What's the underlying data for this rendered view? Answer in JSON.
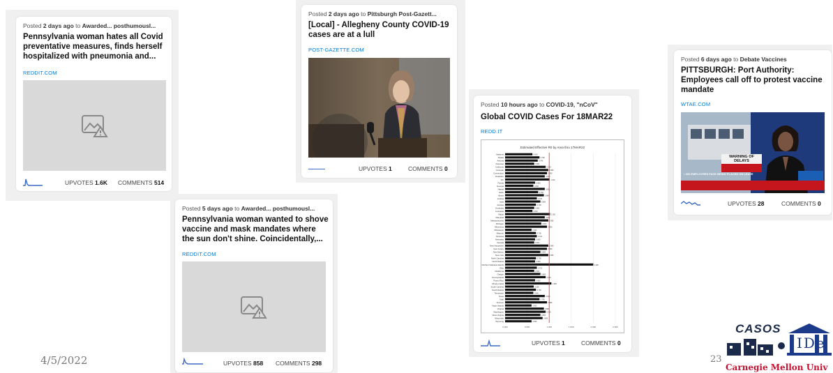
{
  "cards": [
    {
      "posted_prefix": "Posted",
      "time": "2 days ago",
      "to": "to",
      "subreddit": "Awarded... posthumousl...",
      "title_lines": [
        "Pennsylvania woman hates all Covid",
        "preventative measures, finds herself",
        "hospitalized with pneumonia and..."
      ],
      "domain": "REDDIT.COM",
      "upvotes_label": "UPVOTES",
      "upvotes": "1.6K",
      "comments_label": "COMMENTS",
      "comments": "514"
    },
    {
      "posted_prefix": "Posted",
      "time": "2 days ago",
      "to": "to",
      "subreddit": "Pittsburgh Post-Gazett...",
      "title_lines": [
        "[Local] - Allegheny County COVID-19",
        "cases are at a lull"
      ],
      "domain": "POST-GAZETTE.COM",
      "upvotes_label": "UPVOTES",
      "upvotes": "1",
      "comments_label": "COMMENTS",
      "comments": "0"
    },
    {
      "posted_prefix": "Posted",
      "time": "5 days ago",
      "to": "to",
      "subreddit": "Awarded... posthumousl...",
      "title_lines": [
        "Pennsylvania woman wanted to shove",
        "vaccine and mask mandates where",
        "the sun don't shine. Coincidentally,..."
      ],
      "domain": "REDDIT.COM",
      "upvotes_label": "UPVOTES",
      "upvotes": "858",
      "comments_label": "COMMENTS",
      "comments": "298"
    },
    {
      "posted_prefix": "Posted",
      "time": "10 hours ago",
      "to": "to",
      "subreddit": "COVID-19, \"nCoV\"",
      "title_lines": [
        "Global COVID Cases For 18MAR22"
      ],
      "domain": "REDD.IT",
      "chart_title": "Estimated Effective R0 by Area thru 17MAR22",
      "upvotes_label": "UPVOTES",
      "upvotes": "1",
      "comments_label": "COMMENTS",
      "comments": "0"
    },
    {
      "posted_prefix": "Posted",
      "time": "6 days ago",
      "to": "to",
      "subreddit": "Debate Vaccines",
      "title_lines": [
        "PITTSBURGH: Port Authority:",
        "Employees call off to protest vaccine",
        "mandate"
      ],
      "domain": "WTAE.COM",
      "thumb_banner": "WARNING OF DELAYS",
      "thumb_sub": "• 300 EMPLOYEES FACE BEING PLACED ON LEAVE",
      "upvotes_label": "UPVOTES",
      "upvotes": "28",
      "comments_label": "COMMENTS",
      "comments": "0"
    }
  ],
  "slide": {
    "date": "4/5/2022",
    "page": "23",
    "logo_casos": "CASOS",
    "logo_ide": "IDe",
    "logo_cmu": "Carnegie Mellon Univ"
  },
  "chart_data": {
    "type": "bar",
    "title": "Estimated Effective R0 by Area thru 17MAR22",
    "orientation": "horizontal",
    "xlim": [
      0,
      2.5
    ],
    "reference_line": 1.0,
    "categories": [
      "Alabama",
      "Alaska",
      "Arizona",
      "Arkansas",
      "California",
      "Colorado",
      "Connecticut",
      "Delaware",
      "DC",
      "Florida",
      "Georgia",
      "Hawaii",
      "Idaho",
      "Illinois",
      "Indiana",
      "Iowa",
      "Kansas",
      "Kentucky",
      "Louisiana",
      "Maine",
      "Maryland",
      "Massachusetts",
      "Michigan",
      "Minnesota",
      "Mississippi",
      "Missouri",
      "Montana",
      "Nebraska",
      "Nevada",
      "New Hampshire",
      "New Jersey",
      "New Mexico",
      "New York",
      "North Carolina",
      "North Dakota",
      "Northern Mariana Islands",
      "Ohio",
      "Oklahoma",
      "Oregon",
      "Pennsylvania",
      "Puerto Rico",
      "Rhode Island",
      "South Carolina",
      "South Dakota",
      "Tennessee",
      "Texas",
      "Utah",
      "Vermont",
      "Virgin Islands",
      "Virginia",
      "Washington",
      "West Virginia",
      "Wisconsin",
      "Wyoming"
    ],
    "values": [
      0.62,
      0.78,
      0.74,
      0.66,
      0.92,
      0.98,
      0.95,
      0.9,
      1.01,
      0.68,
      0.64,
      0.9,
      0.75,
      0.88,
      0.72,
      0.8,
      0.7,
      0.66,
      0.62,
      1.02,
      0.9,
      0.98,
      0.82,
      0.95,
      0.6,
      0.7,
      0.72,
      0.68,
      0.66,
      0.98,
      0.95,
      0.8,
      0.98,
      0.7,
      0.68,
      2.0,
      0.72,
      0.66,
      0.8,
      0.92,
      0.68,
      1.05,
      0.65,
      0.7,
      0.64,
      0.9,
      0.78,
      0.95,
      0.6,
      0.88,
      0.92,
      0.8,
      0.85,
      0.6
    ]
  }
}
